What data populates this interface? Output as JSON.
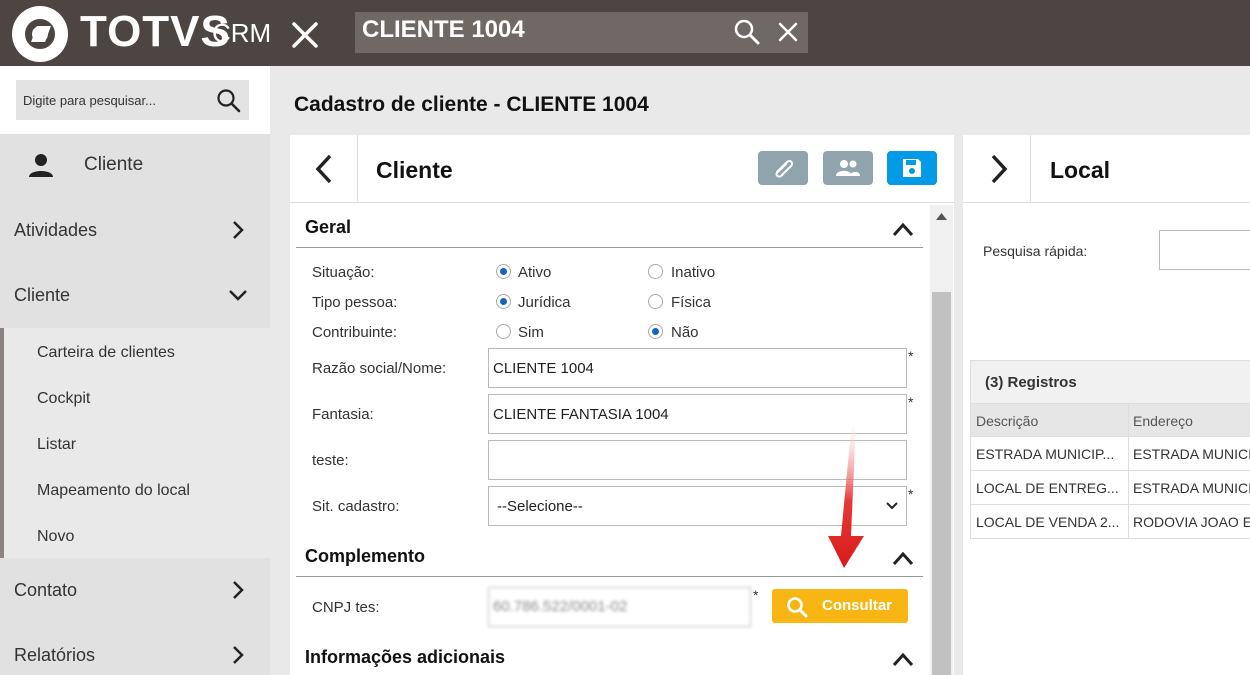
{
  "topbar": {
    "brand": "TOTVS",
    "brand_suffix": "CRM",
    "search_value": "CLIENTE 1004"
  },
  "sidebar": {
    "search_placeholder": "Digite para pesquisar...",
    "user_label": "Cliente",
    "items": [
      {
        "label": "Atividades"
      },
      {
        "label": "Cliente"
      },
      {
        "label": "Contato"
      },
      {
        "label": "Relatórios"
      }
    ],
    "subitems": [
      {
        "label": "Carteira de clientes"
      },
      {
        "label": "Cockpit"
      },
      {
        "label": "Listar"
      },
      {
        "label": "Mapeamento do local"
      },
      {
        "label": "Novo"
      }
    ]
  },
  "main": {
    "page_title": "Cadastro de cliente - CLIENTE 1004",
    "panel_title": "Cliente",
    "sections": {
      "geral": "Geral",
      "complemento": "Complemento",
      "info": "Informações adicionais"
    },
    "fields": {
      "situacao": {
        "label": "Situação:",
        "opt1": "Ativo",
        "opt2": "Inativo",
        "selected": "Ativo"
      },
      "tipo_pessoa": {
        "label": "Tipo pessoa:",
        "opt1": "Jurídica",
        "opt2": "Física",
        "selected": "Jurídica"
      },
      "contribuinte": {
        "label": "Contribuinte:",
        "opt1": "Sim",
        "opt2": "Não",
        "selected": "Não"
      },
      "razao": {
        "label": "Razão social/Nome:",
        "value": "CLIENTE 1004"
      },
      "fantasia": {
        "label": "Fantasia:",
        "value": "CLIENTE FANTASIA 1004"
      },
      "teste": {
        "label": "teste:",
        "value": ""
      },
      "sit_cadastro": {
        "label": "Sit. cadastro:",
        "value": "--Selecione--"
      },
      "cnpj": {
        "label": "CNPJ tes:",
        "value": "60.786.522/0001-02"
      }
    },
    "required_mark": "*",
    "consultar_label": "Consultar"
  },
  "right": {
    "title": "Local",
    "quick_search_label": "Pesquisa rápida:",
    "grid_title": "(3) Registros",
    "columns": [
      "Descrição",
      "Endereço"
    ],
    "rows": [
      [
        "ESTRADA MUNICIP...",
        "ESTRADA MUNICIPAL"
      ],
      [
        "LOCAL DE ENTREG...",
        "ESTRADA MUNICIPAL"
      ],
      [
        "LOCAL DE VENDA 2...",
        "RODOVIA JOAO E"
      ]
    ]
  },
  "colors": {
    "topbar": "#4d4541",
    "accent_blue": "#039be5",
    "consultar": "#f7b614",
    "arrow": "#e53935"
  }
}
